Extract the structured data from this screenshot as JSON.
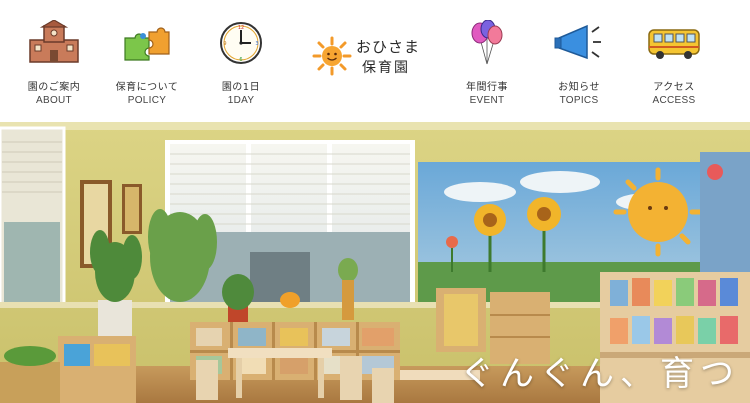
{
  "brand": {
    "name_line1": "おひさま",
    "name_line2": "保育園"
  },
  "nav": {
    "items": [
      {
        "jp": "園のご案内",
        "en": "ABOUT",
        "icon": "school-building-icon"
      },
      {
        "jp": "保育について",
        "en": "POLICY",
        "icon": "puzzle-pieces-icon"
      },
      {
        "jp": "園の1日",
        "en": "1DAY",
        "icon": "clock-icon"
      },
      {
        "jp": "年間行事",
        "en": "EVENT",
        "icon": "balloons-icon"
      },
      {
        "jp": "お知らせ",
        "en": "TOPICS",
        "icon": "megaphone-icon"
      },
      {
        "jp": "アクセス",
        "en": "ACCESS",
        "icon": "bus-icon"
      }
    ]
  },
  "hero": {
    "tagline": "ぐんぐん、育つ"
  },
  "colors": {
    "wall": "#d8d27a",
    "sun_orange": "#f39a2a",
    "text_dark": "#333333"
  }
}
